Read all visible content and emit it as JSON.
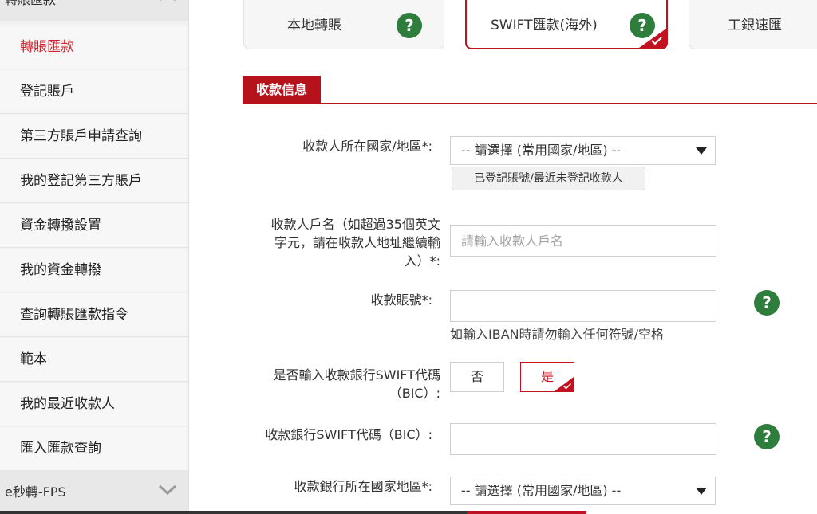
{
  "sidebar": {
    "top_group": "轉賬匯款",
    "items": [
      {
        "label": "轉賬匯款",
        "active": true
      },
      {
        "label": "登記賬戶"
      },
      {
        "label": "第三方賬戶申請查詢"
      },
      {
        "label": "我的登記第三方賬戶"
      },
      {
        "label": "資金轉撥設置"
      },
      {
        "label": "我的資金轉撥"
      },
      {
        "label": "查詢轉賬匯款指令"
      },
      {
        "label": "範本"
      },
      {
        "label": "我的最近收款人"
      },
      {
        "label": "匯入匯款查詢"
      }
    ],
    "bottom_group": "e秒轉-FPS"
  },
  "tabs": [
    {
      "label": "本地轉賬"
    },
    {
      "label": "SWIFT匯款(海外)",
      "active": true
    },
    {
      "label": "工銀速匯"
    }
  ],
  "section": {
    "title": "收款信息"
  },
  "form": {
    "country": {
      "label": "收款人所在國家/地區*:",
      "value": "-- 請選擇 (常用國家/地區) --",
      "lookup_button": "已登記賬號/最近未登記收款人"
    },
    "account_name": {
      "label_line1": "收款人戶名（如超過35個英文",
      "label_line2": "字元，請在收款人地址繼續輸",
      "label_line3": "入）*:",
      "placeholder": "請輸入收款人戶名"
    },
    "account_no": {
      "label": "收款賬號*:",
      "hint": "如輸入IBAN時請勿輸入任何符號/空格"
    },
    "swift_toggle": {
      "label_line1": "是否輸入收款銀行SWIFT代碼",
      "label_line2": "（BIC）:",
      "no": "否",
      "yes": "是"
    },
    "swift_code": {
      "label": "收款銀行SWIFT代碼（BIC）:"
    },
    "bank_country": {
      "label": "收款銀行所在國家地區*:",
      "value": "-- 請選擇 (常用國家/地區) --"
    }
  },
  "help_icon_text": "?",
  "colors": {
    "brand_red": "#b5121b",
    "help_green": "#2e7d3c",
    "active_text": "#d4212c"
  }
}
